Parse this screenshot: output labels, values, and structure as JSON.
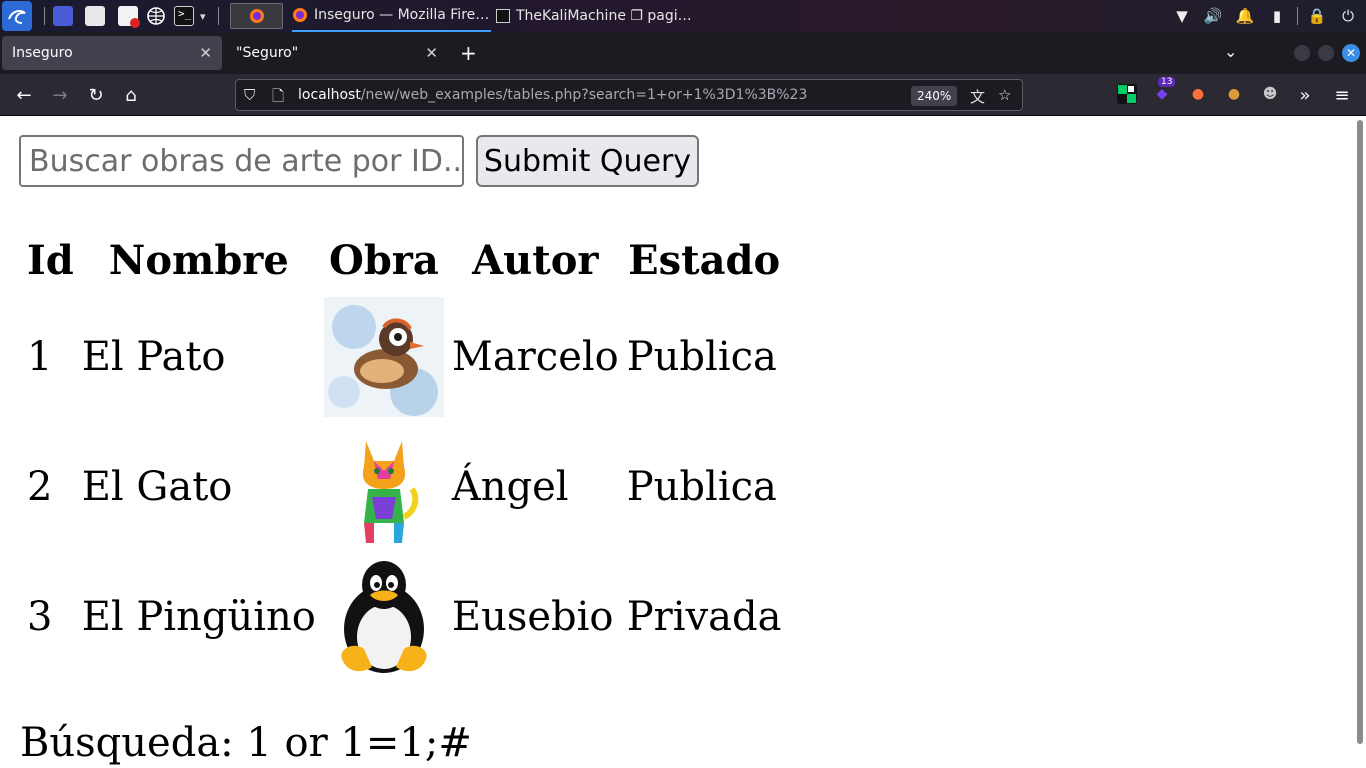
{
  "taskbar": {
    "tasks": [
      {
        "label": "Inseguro — Mozilla Fire…",
        "active": true
      },
      {
        "label": "TheKaliMachine ❐ pagi…",
        "active": false
      }
    ]
  },
  "browser": {
    "tabs": [
      {
        "label": "Inseguro",
        "selected": true
      },
      {
        "label": "\"Seguro\"",
        "selected": false
      }
    ],
    "new_tab_label": "+",
    "url_host": "localhost",
    "url_path": "/new/web_examples/tables.php?search=1+or+1%3D1%3B%23",
    "zoom": "240%",
    "extension_badge": "13"
  },
  "page": {
    "search": {
      "placeholder": "Buscar obras de arte por ID...",
      "value": ""
    },
    "submit_label": "Submit Query",
    "table": {
      "headers": [
        "Id",
        "Nombre",
        "Obra",
        "Autor",
        "Estado"
      ],
      "rows": [
        {
          "id": "1",
          "nombre": "El Pato",
          "obra": "duck-watercolor",
          "autor": "Marcelo",
          "estado": "Publica"
        },
        {
          "id": "2",
          "nombre": "El Gato",
          "obra": "colorful-cat",
          "autor": "Ángel",
          "estado": "Publica"
        },
        {
          "id": "3",
          "nombre": "El Pingüino",
          "obra": "tux-penguin",
          "autor": "Eusebio",
          "estado": "Privada"
        }
      ]
    },
    "result_text": "Búsqueda: 1 or 1=1;#"
  },
  "colors": {
    "taskbar_bg": "#1d1f2c",
    "tabstrip_bg": "#1c1b22",
    "selected_tab_bg": "#42414d",
    "navbar_bg": "#2b2a33",
    "accent": "#3aa0ff"
  }
}
